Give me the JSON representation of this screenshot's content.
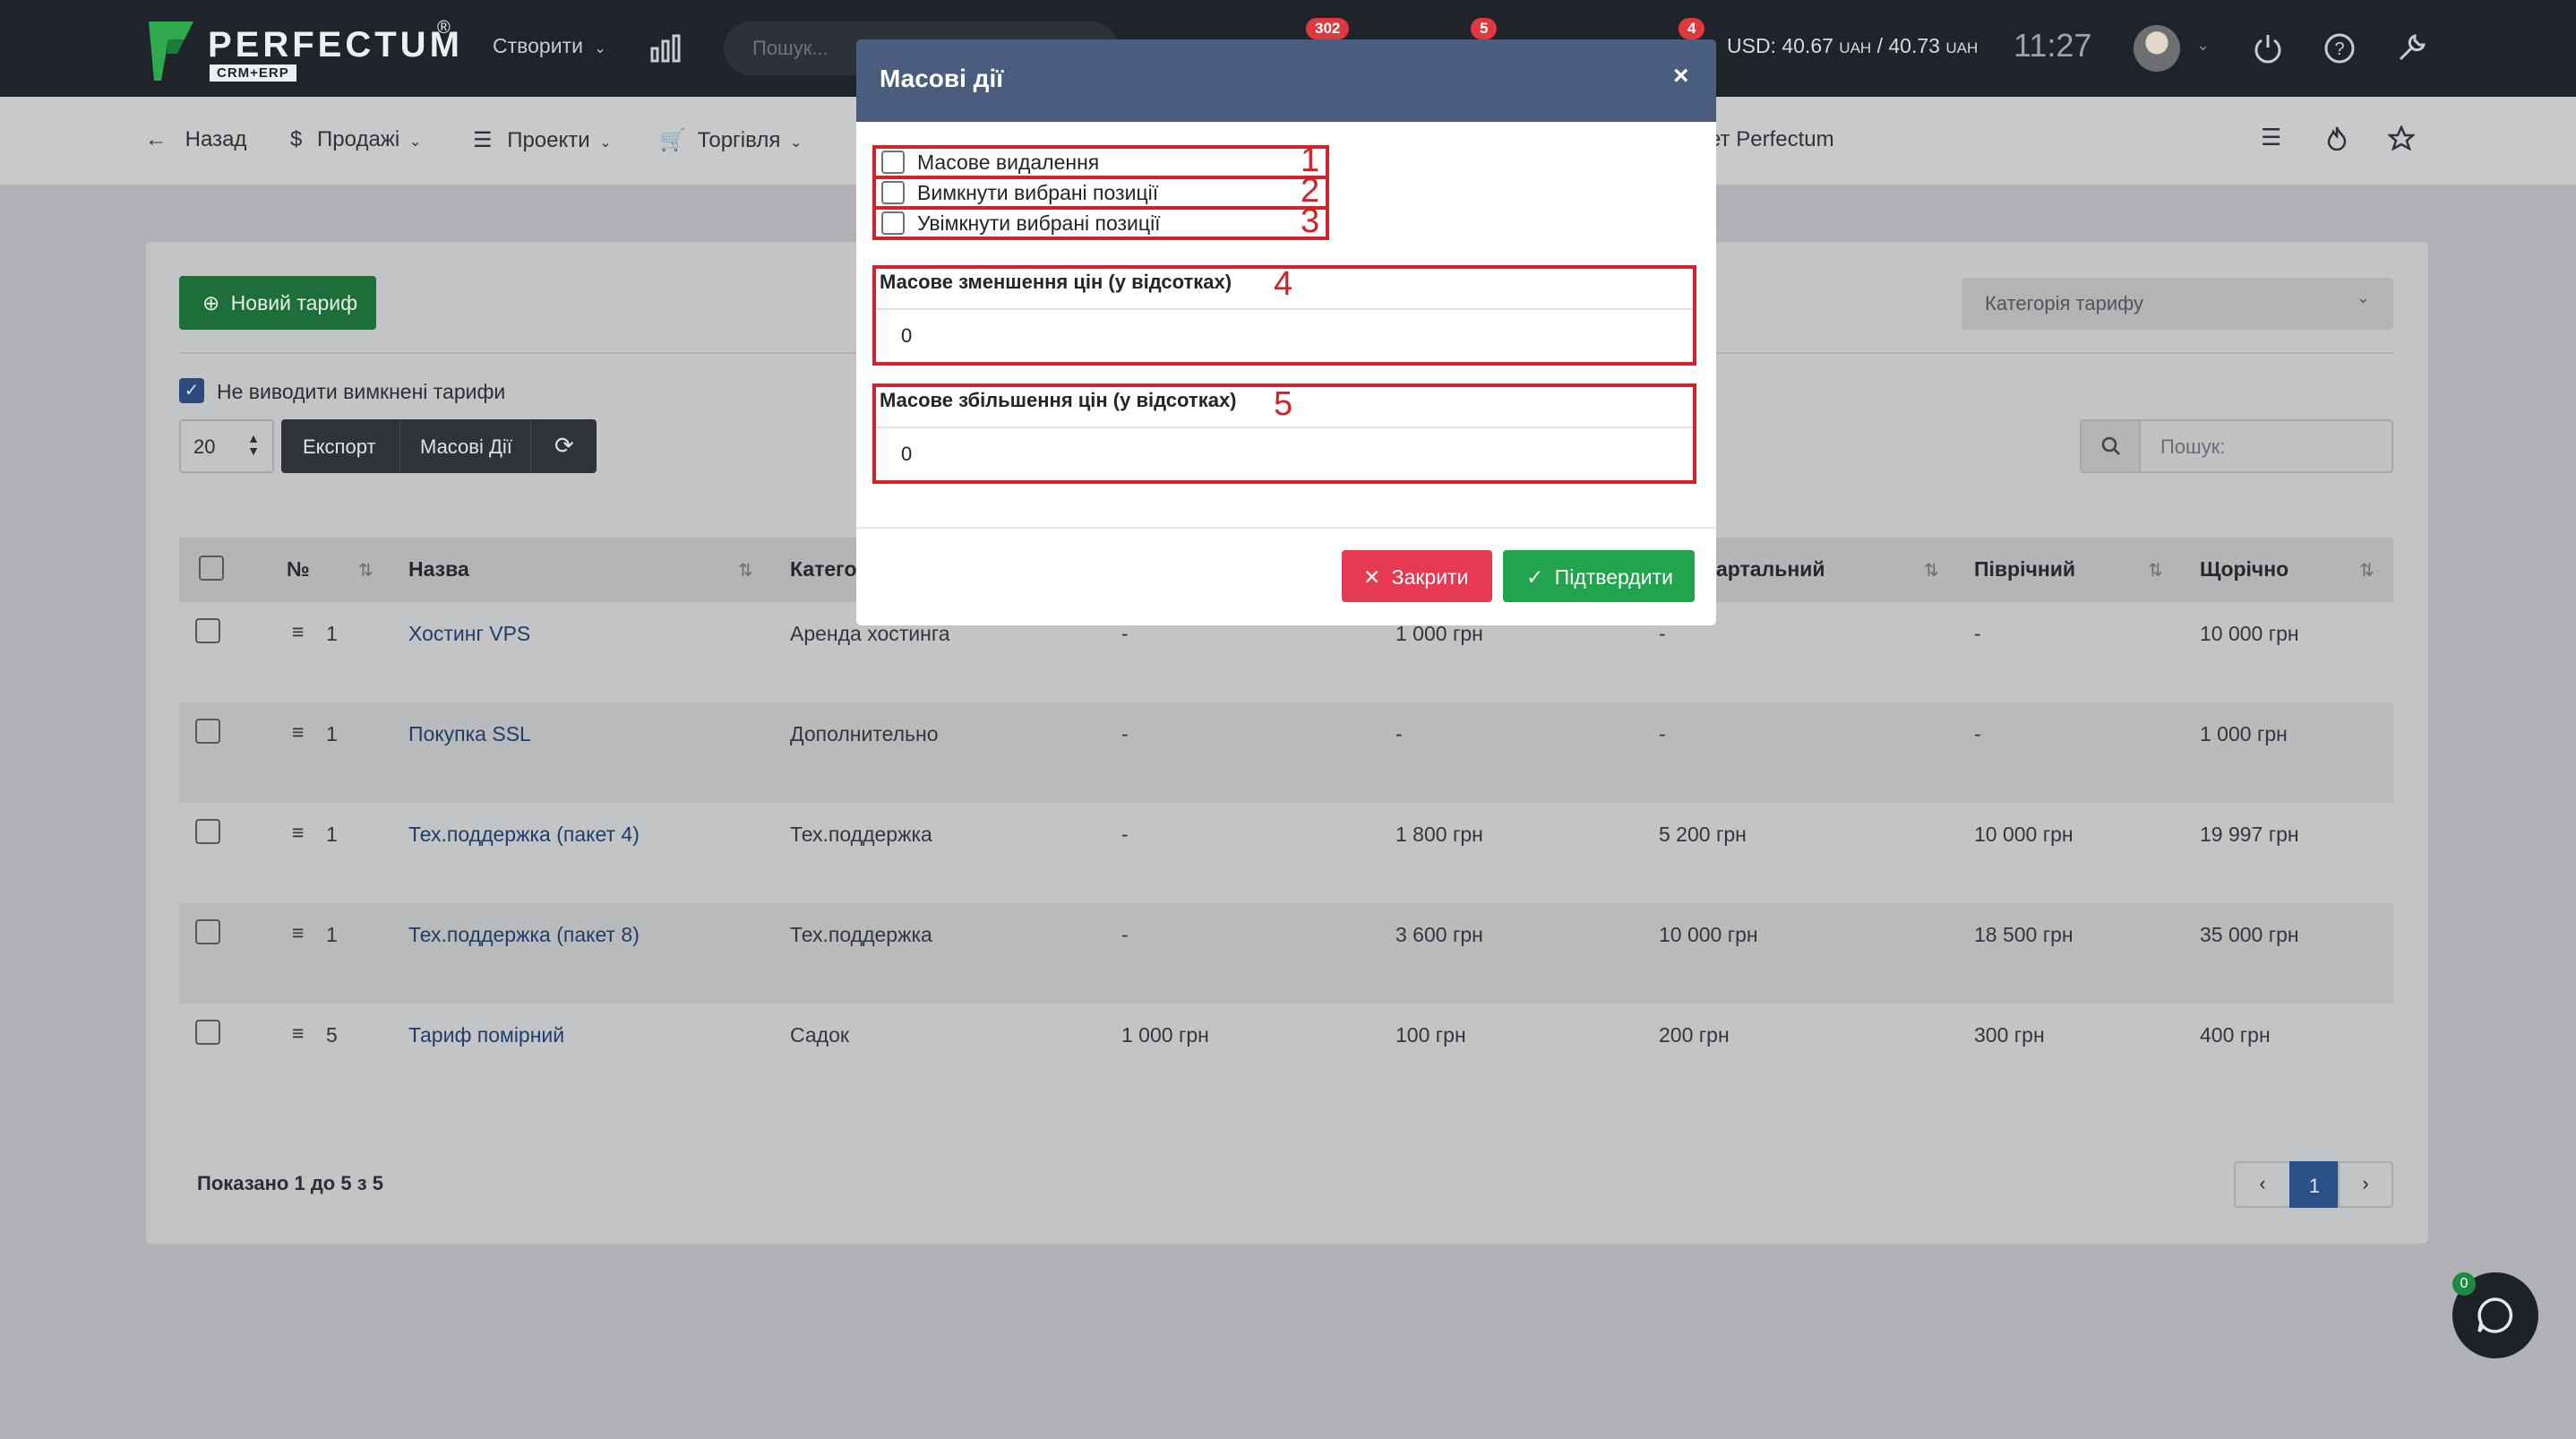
{
  "topbar": {
    "logo_word": "PERFECTUM",
    "logo_reg": "®",
    "logo_sub": "CRM+ERP",
    "create_label": "Створити",
    "search_placeholder": "Пошук...",
    "badges": [
      "302",
      "5",
      "4"
    ],
    "rate": "USD: 40.67",
    "rate_unit1": "UAH",
    "rate_sep": "/ 40.73",
    "rate_unit2": "UAH",
    "time": "11:27"
  },
  "navbar": {
    "back": "Назад",
    "sales": "Продажі",
    "projects": "Проекти",
    "trade": "Торгівля",
    "partial_item": "ет Perfectum"
  },
  "toolbar": {
    "new_tariff": "Новий тариф",
    "category_select": "Категорія тарифу",
    "hide_disabled_label": "Не виводити вимкнені тарифи",
    "page_size": "20",
    "export": "Експорт",
    "mass_actions": "Масові Дії",
    "search_placeholder": "Пошук:"
  },
  "table": {
    "headers": {
      "num": "№",
      "name": "Назва",
      "category": "Катего",
      "quarterly": "артальний",
      "semiannual": "Піврічний",
      "yearly": "Щорічно"
    },
    "rows": [
      {
        "num": "1",
        "name": "Хостинг VPS",
        "category": "Аренда хостинга",
        "c1": "-",
        "c2": "1 000 грн",
        "c3": "-",
        "c4": "-",
        "c5": "10 000 грн"
      },
      {
        "num": "1",
        "name": "Покупка SSL",
        "category": "Дополнительно",
        "c1": "-",
        "c2": "-",
        "c3": "-",
        "c4": "-",
        "c5": "1 000 грн"
      },
      {
        "num": "1",
        "name": "Тех.поддержка (пакет 4)",
        "category": "Тех.поддержка",
        "c1": "-",
        "c2": "1 800 грн",
        "c3": "5 200 грн",
        "c4": "10 000 грн",
        "c5": "19 997 грн"
      },
      {
        "num": "1",
        "name": "Тех.поддержка (пакет 8)",
        "category": "Тех.поддержка",
        "c1": "-",
        "c2": "3 600 грн",
        "c3": "10 000 грн",
        "c4": "18 500 грн",
        "c5": "35 000 грн"
      },
      {
        "num": "5",
        "name": "Тариф помірний",
        "category": "Садок",
        "c1": "1 000 грн",
        "c2": "100 грн",
        "c3": "200 грн",
        "c4": "300 грн",
        "c5": "400 грн"
      }
    ],
    "summary": "Показано 1 до 5 з 5",
    "current_page": "1"
  },
  "chat": {
    "badge": "0"
  },
  "modal": {
    "title": "Масові дії",
    "close_glyph": "×",
    "options": [
      {
        "label": "Масове видалення",
        "marker": "1"
      },
      {
        "label": "Вимкнути вибрані позиції",
        "marker": "2"
      },
      {
        "label": "Увімкнути вибрані позиції",
        "marker": "3"
      }
    ],
    "decrease": {
      "label": "Масове зменшення цін (у відсотках)",
      "value": "0",
      "marker": "4"
    },
    "increase": {
      "label": "Масове збільшення цін (у відсотках)",
      "value": "0",
      "marker": "5"
    },
    "close_btn": "Закрити",
    "confirm_btn": "Підтвердити"
  },
  "colors": {
    "topbar": "#1f242a",
    "modal_header": "#4a5d7e",
    "confirm": "#22a34d",
    "close": "#e53a52",
    "annotation": "#d1232a"
  }
}
